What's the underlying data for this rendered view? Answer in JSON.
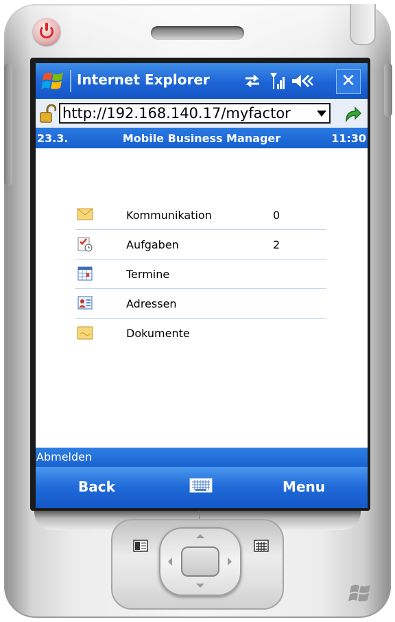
{
  "browser": {
    "app_title": "Internet Explorer",
    "url": "http://192.168.140.17/myfactor",
    "icons": [
      "windows-logo",
      "sync-icon",
      "signal-icon",
      "volume-icon",
      "close-icon",
      "lock-icon",
      "go-arrow-icon"
    ],
    "close_label": "✕"
  },
  "info_bar": {
    "date": "23.3.",
    "title": "Mobile Business Manager",
    "time": "11:30"
  },
  "menu": {
    "items": [
      {
        "label": "Kommunikation",
        "count": "0",
        "icon": "envelope-icon"
      },
      {
        "label": "Aufgaben",
        "count": "2",
        "icon": "tasks-icon"
      },
      {
        "label": "Termine",
        "count": "",
        "icon": "calendar-icon"
      },
      {
        "label": "Adressen",
        "count": "",
        "icon": "contacts-icon"
      },
      {
        "label": "Dokumente",
        "count": "",
        "icon": "document-icon"
      }
    ]
  },
  "logout_label": "Abmelden",
  "softkeys": {
    "left": "Back",
    "right": "Menu",
    "center_icon": "keyboard-icon"
  },
  "colors": {
    "accent_blue": "#1d64d6",
    "row_divider": "#b9d1ea",
    "power_red": "#d92a2a"
  }
}
